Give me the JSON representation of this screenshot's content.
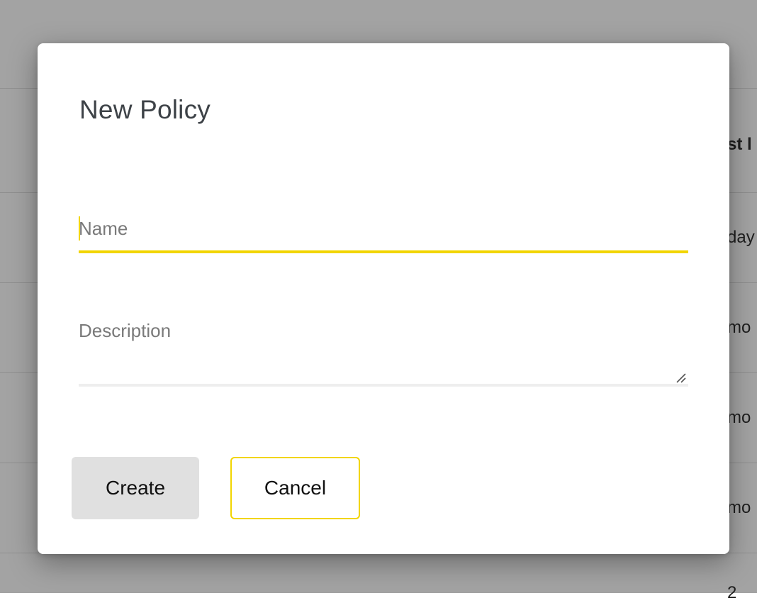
{
  "background": {
    "header_fragment": "st l",
    "row_fragments": [
      "day",
      "mo",
      "mo",
      "mo",
      "2"
    ]
  },
  "modal": {
    "title": "New Policy",
    "name_field": {
      "value": "",
      "placeholder": "Name"
    },
    "description_field": {
      "value": "",
      "placeholder": "Description"
    },
    "buttons": {
      "create": "Create",
      "cancel": "Cancel"
    }
  },
  "colors": {
    "accent": "#f2d500",
    "backdrop": "#a3a3a3",
    "secondary_button": "#e0e0e0"
  },
  "icons": [
    "resize-handle-icon"
  ]
}
